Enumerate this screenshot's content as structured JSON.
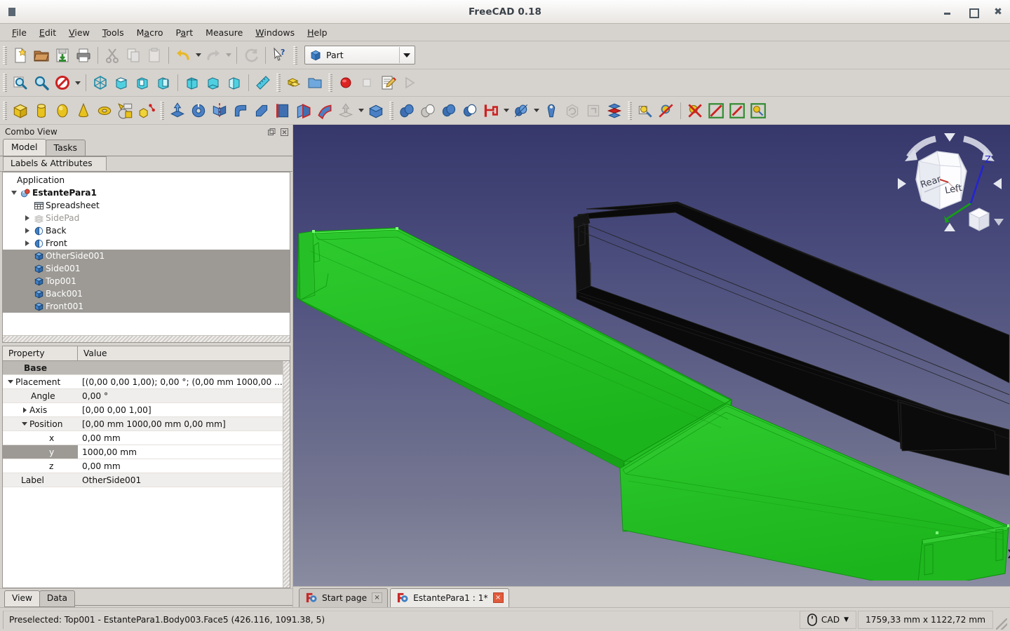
{
  "window": {
    "title": "FreeCAD 0.18",
    "minimize_label": "Minimize",
    "maximize_label": "Maximize",
    "close_label": "Close"
  },
  "menubar": {
    "items": [
      {
        "label": "File",
        "mnemonic": "F"
      },
      {
        "label": "Edit",
        "mnemonic": "E"
      },
      {
        "label": "View",
        "mnemonic": "V"
      },
      {
        "label": "Tools",
        "mnemonic": "T"
      },
      {
        "label": "Macro",
        "mnemonic": "M"
      },
      {
        "label": "Part",
        "mnemonic": "P"
      },
      {
        "label": "Measure",
        "mnemonic": ""
      },
      {
        "label": "Windows",
        "mnemonic": "W"
      },
      {
        "label": "Help",
        "mnemonic": "H"
      }
    ]
  },
  "toolbars": {
    "file": [
      {
        "name": "new-document-icon",
        "tooltip": "New"
      },
      {
        "name": "open-document-icon",
        "tooltip": "Open"
      },
      {
        "name": "save-document-icon",
        "tooltip": "Save"
      },
      {
        "name": "print-icon",
        "tooltip": "Print"
      },
      {
        "name": "cut-icon",
        "tooltip": "Cut"
      },
      {
        "name": "copy-icon",
        "tooltip": "Copy"
      },
      {
        "name": "paste-icon",
        "tooltip": "Paste"
      },
      {
        "name": "undo-icon",
        "tooltip": "Undo"
      },
      {
        "name": "redo-icon",
        "tooltip": "Redo"
      },
      {
        "name": "refresh-icon",
        "tooltip": "Refresh"
      },
      {
        "name": "whats-this-icon",
        "tooltip": "What's This"
      }
    ],
    "workbench": {
      "selected": "Part",
      "icon": "part-workbench-icon"
    },
    "view": [
      {
        "name": "fit-all-icon",
        "tooltip": "Fit all"
      },
      {
        "name": "fit-selection-icon",
        "tooltip": "Fit selection"
      },
      {
        "name": "draw-style-icon",
        "tooltip": "Draw style"
      },
      {
        "name": "isometric-view-icon",
        "tooltip": "Axonometric"
      },
      {
        "name": "front-view-icon",
        "tooltip": "Front"
      },
      {
        "name": "top-view-icon",
        "tooltip": "Top"
      },
      {
        "name": "right-view-icon",
        "tooltip": "Right"
      },
      {
        "name": "rear-view-icon",
        "tooltip": "Rear"
      },
      {
        "name": "bottom-view-icon",
        "tooltip": "Bottom"
      },
      {
        "name": "left-view-icon",
        "tooltip": "Left"
      },
      {
        "name": "measure-icon",
        "tooltip": "Measure"
      }
    ],
    "structure": [
      {
        "name": "create-part-icon",
        "tooltip": "Create part"
      },
      {
        "name": "create-group-icon",
        "tooltip": "Create group"
      }
    ],
    "macro": [
      {
        "name": "macro-record-icon",
        "tooltip": "Macro recording"
      },
      {
        "name": "macro-stop-icon",
        "tooltip": "Stop macro recording"
      },
      {
        "name": "macro-edit-icon",
        "tooltip": "Macros"
      },
      {
        "name": "macro-execute-icon",
        "tooltip": "Execute macro"
      }
    ],
    "primitives": [
      {
        "name": "box-icon",
        "tooltip": "Cube"
      },
      {
        "name": "cylinder-icon",
        "tooltip": "Cylinder"
      },
      {
        "name": "sphere-icon",
        "tooltip": "Sphere"
      },
      {
        "name": "cone-icon",
        "tooltip": "Cone"
      },
      {
        "name": "torus-icon",
        "tooltip": "Torus"
      },
      {
        "name": "create-primitives-icon",
        "tooltip": "Create primitives"
      },
      {
        "name": "shape-builder-icon",
        "tooltip": "Shape builder"
      }
    ],
    "modeling": [
      {
        "name": "extrude-icon",
        "tooltip": "Extrude"
      },
      {
        "name": "revolve-icon",
        "tooltip": "Revolve"
      },
      {
        "name": "mirror-icon",
        "tooltip": "Mirroring"
      },
      {
        "name": "fillet-icon",
        "tooltip": "Fillet"
      },
      {
        "name": "chamfer-icon",
        "tooltip": "Chamfer"
      },
      {
        "name": "ruled-surface-icon",
        "tooltip": "Ruled surface"
      },
      {
        "name": "loft-icon",
        "tooltip": "Loft"
      },
      {
        "name": "sweep-icon",
        "tooltip": "Sweep"
      },
      {
        "name": "offset-icon",
        "tooltip": "3D Offset"
      },
      {
        "name": "thickness-icon",
        "tooltip": "Thickness"
      }
    ],
    "boolean": [
      {
        "name": "compound-icon",
        "tooltip": "Compound"
      },
      {
        "name": "boolean-icon",
        "tooltip": "Boolean"
      },
      {
        "name": "union-icon",
        "tooltip": "Union"
      },
      {
        "name": "cut-shape-icon",
        "tooltip": "Cut"
      },
      {
        "name": "join-connect-icon",
        "tooltip": "Join objects"
      },
      {
        "name": "split-icon",
        "tooltip": "Split objects"
      },
      {
        "name": "attachment-icon",
        "tooltip": "Attachment"
      },
      {
        "name": "convert-solid-icon",
        "tooltip": "Convert to solid"
      },
      {
        "name": "reverse-shape-icon",
        "tooltip": "Reverse shapes"
      },
      {
        "name": "cross-sections-icon",
        "tooltip": "Cross-sections"
      }
    ],
    "measure": [
      {
        "name": "measure-linear-icon",
        "tooltip": "Measure linear"
      },
      {
        "name": "measure-angular-icon",
        "tooltip": "Measure angular"
      },
      {
        "name": "measure-clear-all-icon",
        "tooltip": "Clear all"
      },
      {
        "name": "measure-toggle-all-icon",
        "tooltip": "Toggle all"
      },
      {
        "name": "measure-toggle-3d-icon",
        "tooltip": "Toggle 3D"
      },
      {
        "name": "measure-toggle-delta-icon",
        "tooltip": "Toggle delta"
      }
    ]
  },
  "combo_view": {
    "title": "Combo View",
    "float_button": "undock-icon",
    "close_button": "close-icon",
    "tabs": [
      {
        "label": "Model",
        "active": true
      },
      {
        "label": "Tasks",
        "active": false
      }
    ],
    "tree_header": "Labels & Attributes",
    "tree": [
      {
        "label": "Application",
        "indent": 0,
        "twist": "none",
        "icon": "none",
        "state": "normal"
      },
      {
        "label": "EstantePara1",
        "indent": 1,
        "twist": "expanded",
        "icon": "document-icon",
        "state": "bold"
      },
      {
        "label": "Spreadsheet",
        "indent": 2,
        "twist": "none",
        "icon": "spreadsheet-icon",
        "state": "normal"
      },
      {
        "label": "SidePad",
        "indent": 2,
        "twist": "collapsed",
        "icon": "pad-icon",
        "state": "dim"
      },
      {
        "label": "Back",
        "indent": 2,
        "twist": "collapsed",
        "icon": "body-icon",
        "state": "normal"
      },
      {
        "label": "Front",
        "indent": 2,
        "twist": "collapsed",
        "icon": "body-icon",
        "state": "normal"
      },
      {
        "label": "OtherSide001",
        "indent": 2,
        "twist": "none",
        "icon": "solid-icon",
        "state": "selected"
      },
      {
        "label": "Side001",
        "indent": 2,
        "twist": "none",
        "icon": "solid-icon",
        "state": "selected"
      },
      {
        "label": "Top001",
        "indent": 2,
        "twist": "none",
        "icon": "solid-icon",
        "state": "selected"
      },
      {
        "label": "Back001",
        "indent": 2,
        "twist": "none",
        "icon": "solid-icon",
        "state": "selected"
      },
      {
        "label": "Front001",
        "indent": 2,
        "twist": "none",
        "icon": "solid-icon",
        "state": "selected"
      }
    ],
    "property_editor": {
      "columns": [
        "Property",
        "Value"
      ],
      "rows": [
        {
          "kind": "group",
          "name": "Base",
          "value": ""
        },
        {
          "kind": "row",
          "name": "Placement",
          "value": "[(0,00 0,00 1,00); 0,00 °; (0,00 mm  1000,00 ...",
          "twist": "expanded",
          "indent": 0
        },
        {
          "kind": "row",
          "name": "Angle",
          "value": "0,00 °",
          "twist": "none",
          "indent": 1
        },
        {
          "kind": "row",
          "name": "Axis",
          "value": "[0,00 0,00 1,00]",
          "twist": "collapsed",
          "indent": 1
        },
        {
          "kind": "row",
          "name": "Position",
          "value": "[0,00 mm  1000,00 mm  0,00 mm]",
          "twist": "expanded",
          "indent": 1
        },
        {
          "kind": "row",
          "name": "x",
          "value": "0,00 mm",
          "twist": "none",
          "indent": 2
        },
        {
          "kind": "row",
          "name": "y",
          "value": "1000,00 mm",
          "twist": "none",
          "indent": 2,
          "selected": true
        },
        {
          "kind": "row",
          "name": "z",
          "value": "0,00 mm",
          "twist": "none",
          "indent": 2
        },
        {
          "kind": "row",
          "name": "Label",
          "value": "OtherSide001",
          "twist": "none",
          "indent": 0
        }
      ]
    },
    "bottom_tabs": [
      {
        "label": "View",
        "active": true
      },
      {
        "label": "Data",
        "active": false
      }
    ]
  },
  "viewport": {
    "background_top": "#36376b",
    "background_bottom": "#8a8ca1",
    "selected_object_color": "#21bd21",
    "unselected_object_color": "#0a0a0a",
    "navigation_cube": {
      "face_rear": "Rear",
      "face_left": "Left",
      "axis_z": "Z"
    },
    "axis_cross": {
      "z": "Z"
    }
  },
  "mdi_tabs": [
    {
      "label": "Start page",
      "active": false,
      "icon": "freecad-icon",
      "close": "×"
    },
    {
      "label": "EstantePara1 : 1*",
      "active": true,
      "icon": "freecad-icon",
      "close": "×"
    }
  ],
  "statusbar": {
    "message": "Preselected: Top001 - EstantePara1.Body003.Face5 (426.116, 1091.38, 5)",
    "navigation_style": "CAD",
    "navigation_icon": "mouse-icon",
    "dimensions": "1759,33 mm x 1122,72 mm"
  }
}
